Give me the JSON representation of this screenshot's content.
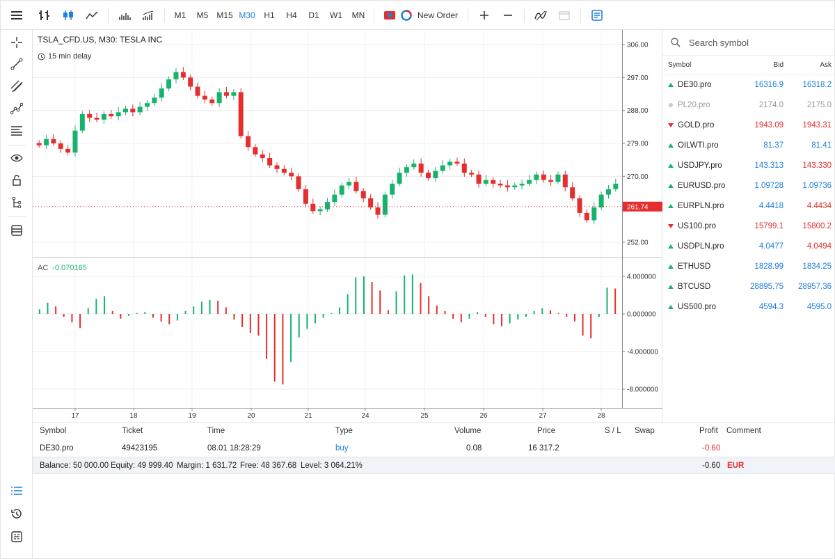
{
  "toolbar": {
    "timeframes": [
      "M1",
      "M5",
      "M15",
      "M30",
      "H1",
      "H4",
      "D1",
      "W1",
      "MN"
    ],
    "active_timeframe": "M30",
    "new_order_label": "New Order"
  },
  "chart": {
    "title": "TSLA_CFD.US, M30: TESLA INC",
    "delay": "15 min delay",
    "price_ticks": [
      "306.00",
      "297.00",
      "288.00",
      "279.00",
      "270.00",
      "261.74",
      "252.00"
    ],
    "current_price": "261.74",
    "indicator_name": "AC",
    "indicator_value": "-0.070165",
    "indicator_ticks": [
      "4.000000",
      "0.000000",
      "-4.000000",
      "-8.000000"
    ],
    "date_ticks": [
      "17",
      "18",
      "19",
      "20",
      "21",
      "24",
      "25",
      "26",
      "27",
      "28"
    ],
    "colors": {
      "up": "#17b36d",
      "down": "#e52e2e",
      "accent": "#1e7fe0"
    }
  },
  "chart_data": {
    "type": "candlestick",
    "x": "M30 bars, dates 17–28",
    "ylim": [
      248,
      310
    ],
    "close_series": [
      278.5,
      280.2,
      279,
      277.5,
      276.5,
      282.5,
      287,
      286,
      285.5,
      287,
      286.4,
      287.5,
      288.5,
      287.5,
      289,
      290,
      291.5,
      294,
      296.5,
      298.5,
      297,
      294.5,
      292,
      291,
      290,
      293,
      292,
      293,
      281,
      278,
      276,
      275,
      273,
      272,
      271,
      270,
      266.5,
      262.5,
      260.5,
      261,
      263,
      265,
      267.5,
      268.5,
      266,
      264,
      261.5,
      259.5,
      265,
      268,
      271,
      272.5,
      273.5,
      271,
      269.5,
      271.5,
      273,
      274,
      273.5,
      271,
      270.5,
      268,
      269,
      268,
      267.5,
      267,
      267.5,
      268,
      269,
      270.5,
      269,
      268.5,
      270.5,
      267,
      264,
      260,
      258,
      261.5,
      265,
      266.5,
      268
    ],
    "ac_series": [
      0.5,
      1.2,
      0.8,
      -0.3,
      -0.9,
      -1.5,
      0.6,
      1.6,
      1.9,
      0.3,
      -0.5,
      -0.2,
      0.1,
      0.2,
      -0.4,
      -0.8,
      -1.1,
      -0.7,
      0.3,
      0.8,
      1.3,
      1.5,
      1.4,
      0.7,
      -0.6,
      -1.4,
      -2.0,
      -2.3,
      -4.8,
      -7.2,
      -7.5,
      -5.1,
      -2.5,
      -1.6,
      -1.0,
      -0.4,
      0.1,
      0.7,
      2.1,
      3.9,
      4.0,
      3.4,
      2.5,
      0.4,
      2.4,
      4.1,
      4.2,
      3.3,
      1.9,
      0.9,
      0.3,
      -0.5,
      -0.9,
      -0.5,
      0.2,
      -0.3,
      -1.1,
      -1.3,
      -1.0,
      -0.6,
      -0.3,
      0.3,
      0.6,
      0.4,
      0.1,
      -0.3,
      -0.8,
      -2.3,
      -2.6,
      -0.3,
      2.8,
      2.7
    ]
  },
  "search": {
    "placeholder": "Search symbol"
  },
  "symbols": {
    "headers": {
      "symbol": "Symbol",
      "bid": "Bid",
      "ask": "Ask"
    },
    "rows": [
      {
        "symbol": "DE30.pro",
        "bid": "16316.9",
        "ask": "16318.2",
        "dir": "up",
        "bid_color": "blue",
        "ask_color": "blue"
      },
      {
        "symbol": "PL20.pro",
        "bid": "2174.0",
        "ask": "2175.0",
        "dir": "none",
        "bid_color": "grey",
        "ask_color": "grey"
      },
      {
        "symbol": "GOLD.pro",
        "bid": "1943.09",
        "ask": "1943.31",
        "dir": "down",
        "bid_color": "red",
        "ask_color": "red"
      },
      {
        "symbol": "OILWTI.pro",
        "bid": "81.37",
        "ask": "81.41",
        "dir": "up",
        "bid_color": "blue",
        "ask_color": "blue"
      },
      {
        "symbol": "USDJPY.pro",
        "bid": "143.313",
        "ask": "143.330",
        "dir": "up",
        "bid_color": "blue",
        "ask_color": "red"
      },
      {
        "symbol": "EURUSD.pro",
        "bid": "1.09728",
        "ask": "1.09736",
        "dir": "up",
        "bid_color": "blue",
        "ask_color": "blue"
      },
      {
        "symbol": "EURPLN.pro",
        "bid": "4.4418",
        "ask": "4.4434",
        "dir": "up",
        "bid_color": "blue",
        "ask_color": "red"
      },
      {
        "symbol": "US100.pro",
        "bid": "15799.1",
        "ask": "15800.2",
        "dir": "down",
        "bid_color": "red",
        "ask_color": "red"
      },
      {
        "symbol": "USDPLN.pro",
        "bid": "4.0477",
        "ask": "4.0494",
        "dir": "up",
        "bid_color": "blue",
        "ask_color": "red"
      },
      {
        "symbol": "ETHUSD",
        "bid": "1828.99",
        "ask": "1834.25",
        "dir": "up",
        "bid_color": "blue",
        "ask_color": "blue"
      },
      {
        "symbol": "BTCUSD",
        "bid": "28895.75",
        "ask": "28957.36",
        "dir": "up",
        "bid_color": "blue",
        "ask_color": "blue"
      },
      {
        "symbol": "US500.pro",
        "bid": "4594.3",
        "ask": "4595.0",
        "dir": "up",
        "bid_color": "blue",
        "ask_color": "blue"
      }
    ]
  },
  "trades": {
    "headers": {
      "symbol": "Symbol",
      "ticket": "Ticket",
      "time": "Time",
      "type": "Type",
      "volume": "Volume",
      "price": "Price",
      "sl": "S / L",
      "swap": "Swap",
      "profit": "Profit",
      "comment": "Comment"
    },
    "row": {
      "symbol": "DE30.pro",
      "ticket": "49423195",
      "time": "08.01 18:28:29",
      "type": "buy",
      "volume": "0.08",
      "price": "16 317.2",
      "profit": "-0.60"
    },
    "summary": {
      "balance": "Balance: 50 000.00",
      "equity": "Equity: 49 999.40",
      "margin": "Margin: 1 631.72",
      "free": "Free: 48 367.68",
      "level": "Level: 3 064.21%",
      "profit": "-0.60",
      "currency": "EUR"
    }
  }
}
